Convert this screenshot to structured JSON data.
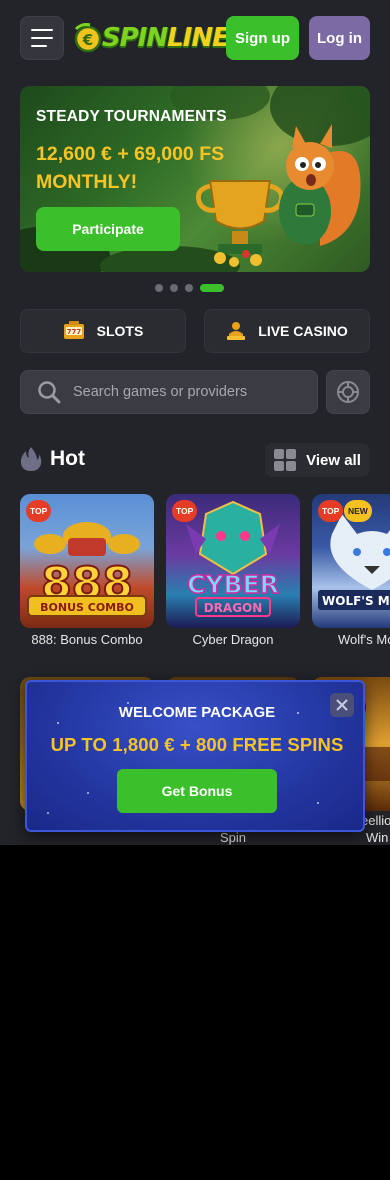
{
  "header": {
    "logo_text_a": "SPIN",
    "logo_text_b": "LINE",
    "signup_label": "Sign up",
    "login_label": "Log in"
  },
  "banner": {
    "title": "STEADY TOURNAMENTS",
    "prize": "12,600 € + 69,000 FS MONTHLY!",
    "cta_label": "Participate",
    "slides_total": 4,
    "active_slide": 4
  },
  "categories": [
    {
      "label": "SLOTS",
      "icon": "slot-machine-icon"
    },
    {
      "label": "LIVE CASINO",
      "icon": "dealer-icon"
    }
  ],
  "search": {
    "placeholder": "Search games or providers"
  },
  "hot": {
    "title": "Hot",
    "view_all_label": "View all",
    "games": [
      {
        "name": "888: Bonus Combo",
        "badges": [
          "TOP"
        ],
        "art_text": "888",
        "art_sub": "BONUS COMBO"
      },
      {
        "name": "Cyber Dragon",
        "badges": [
          "TOP"
        ],
        "art_text": "CYBER",
        "art_sub": "DRAGON"
      },
      {
        "name": "Wolf's Mo",
        "badges": [
          "TOP",
          "NEW"
        ],
        "art_text": "WOLF'S MO"
      }
    ],
    "row2_labels": [
      "Spin",
      "eellio",
      "Win"
    ]
  },
  "popup": {
    "title": "WELCOME PACKAGE",
    "offer": "UP TO 1,800 € + 800 FREE SPINS",
    "cta_label": "Get Bonus"
  },
  "colors": {
    "accent_green": "#3bbf2a",
    "login_purple": "#7b6aa3",
    "gold": "#f7c425",
    "background": "#232429"
  }
}
